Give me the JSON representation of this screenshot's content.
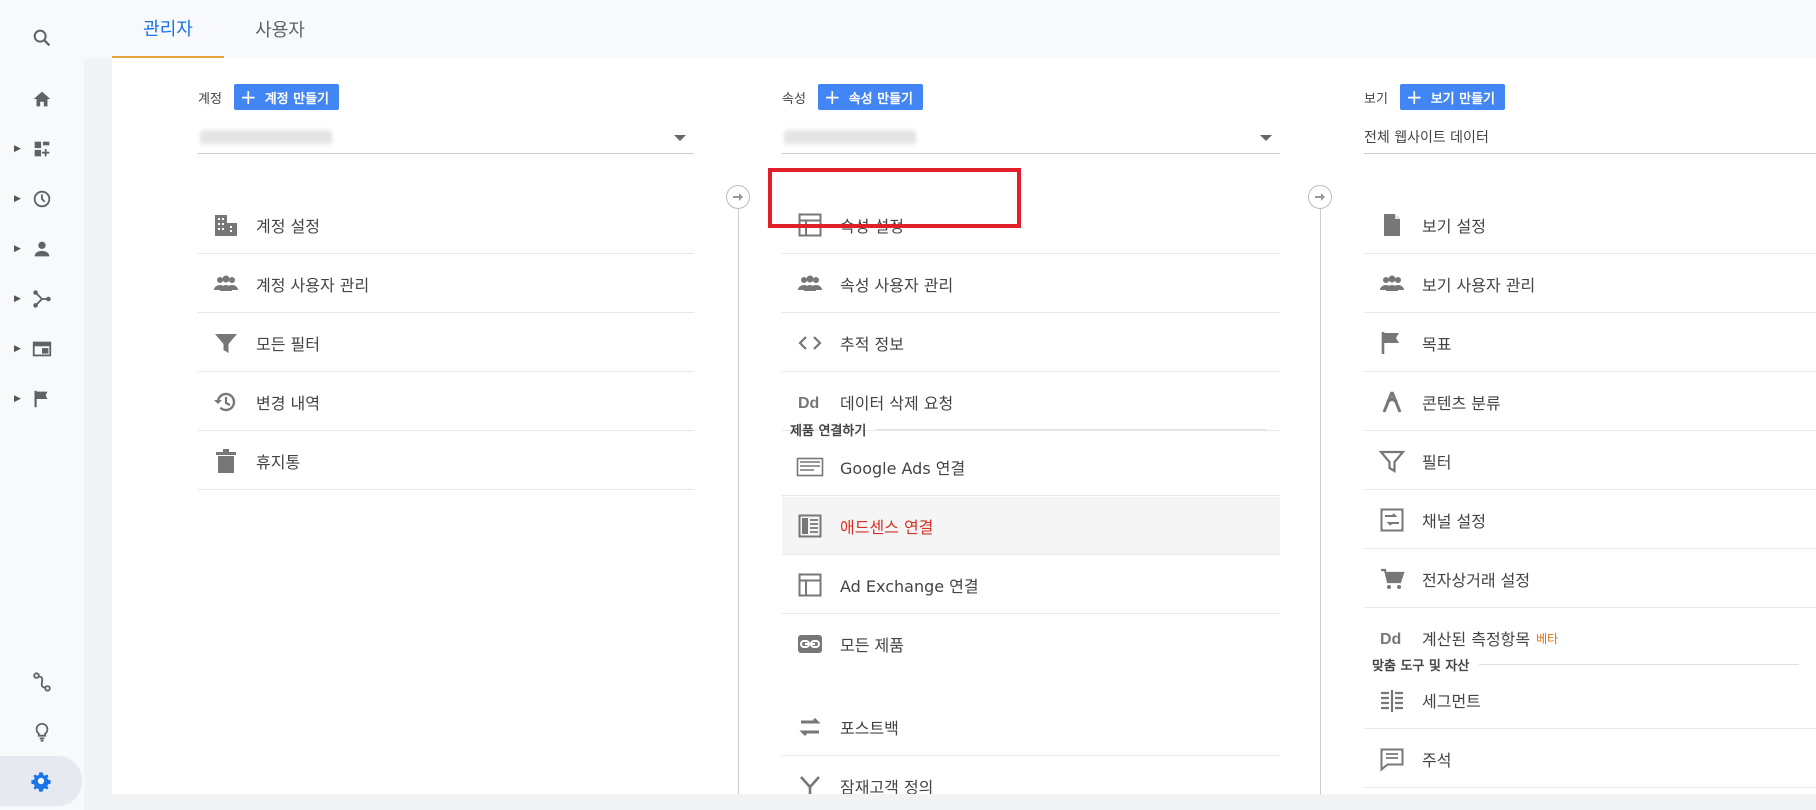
{
  "tabs": [
    {
      "label": "관리자",
      "active": true
    },
    {
      "label": "사용자",
      "active": false
    }
  ],
  "account_col": {
    "label": "계정",
    "create_button": "계정 만들기",
    "items": [
      {
        "icon": "building-icon",
        "label": "계정 설정"
      },
      {
        "icon": "people-icon",
        "label": "계정 사용자 관리"
      },
      {
        "icon": "filter-icon",
        "label": "모든 필터"
      },
      {
        "icon": "history-icon",
        "label": "변경 내역"
      },
      {
        "icon": "trash-icon",
        "label": "휴지통"
      }
    ]
  },
  "property_col": {
    "label": "속성",
    "create_button": "속성 만들기",
    "items": [
      {
        "icon": "layout-icon",
        "label": "속성 설정"
      },
      {
        "icon": "people-icon",
        "label": "속성 사용자 관리"
      },
      {
        "icon": "code-icon",
        "label": "추적 정보"
      },
      {
        "icon": "dd-icon",
        "label": "데이터 삭제 요청"
      }
    ],
    "section_title": "제품 연결하기",
    "links": [
      {
        "icon": "ads-icon",
        "label": "Google Ads 연결"
      },
      {
        "icon": "adsense-icon",
        "label": "애드센스 연결"
      },
      {
        "icon": "layout-icon",
        "label": "Ad Exchange 연결"
      },
      {
        "icon": "link-icon",
        "label": "모든 제품"
      },
      {
        "icon": "postback-icon",
        "label": "포스트백"
      },
      {
        "icon": "audience-icon",
        "label": "잠재고객 정의"
      }
    ]
  },
  "view_col": {
    "label": "보기",
    "create_button": "보기 만들기",
    "selected_view": "전체 웹사이트 데이터",
    "items": [
      {
        "icon": "document-icon",
        "label": "보기 설정"
      },
      {
        "icon": "people-icon",
        "label": "보기 사용자 관리"
      },
      {
        "icon": "flag-icon",
        "label": "목표"
      },
      {
        "icon": "grouping-icon",
        "label": "콘텐츠 분류"
      },
      {
        "icon": "filter-icon",
        "label": "필터"
      },
      {
        "icon": "channel-icon",
        "label": "채널 설정"
      },
      {
        "icon": "cart-icon",
        "label": "전자상거래 설정"
      },
      {
        "icon": "dd-icon",
        "label": "계산된 측정항목",
        "badge": "베타"
      }
    ],
    "section_title": "맞춤 도구 및 자산",
    "tools": [
      {
        "icon": "segment-icon",
        "label": "세그먼트"
      },
      {
        "icon": "comment-icon",
        "label": "주석"
      }
    ]
  },
  "colors": {
    "accent": "#1a73e8",
    "button": "#4285f4",
    "highlight_border": "#e01f2a",
    "adsense_text": "#d93025",
    "beta": "#e8710a"
  }
}
